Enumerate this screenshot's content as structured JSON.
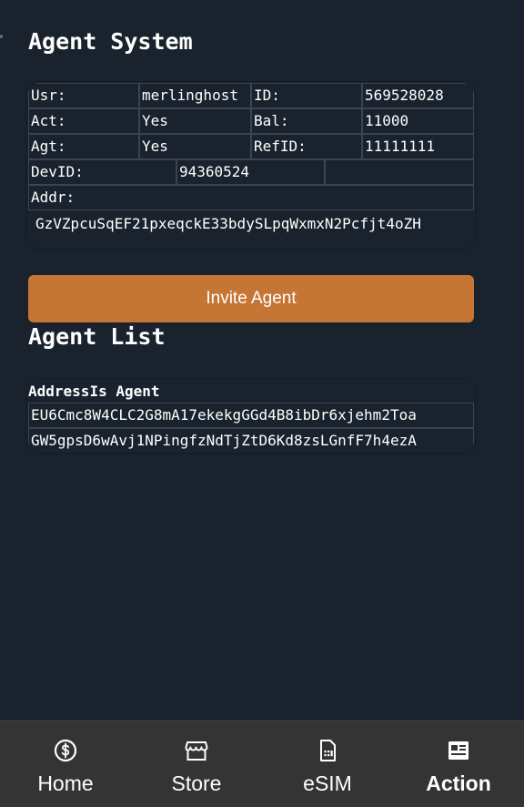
{
  "header": {
    "title": "Agent System"
  },
  "info": {
    "usr_label": "Usr:",
    "usr_value": "merlinghost",
    "id_label": "ID:",
    "id_value": "569528028",
    "act_label": "Act:",
    "act_value": "Yes",
    "bal_label": "Bal:",
    "bal_value": "11000",
    "agt_label": "Agt:",
    "agt_value": "Yes",
    "refid_label": "RefID:",
    "refid_value": "11111111",
    "devid_label": "DevID:",
    "devid_value": "94360524",
    "addr_label": "Addr:",
    "addr_value": "GzVZpcuSqEF21pxeqckE33bdySLpqWxmxN2Pcfjt4oZH"
  },
  "invite_button": {
    "label": "Invite Agent",
    "color": "#c57634"
  },
  "agent_list": {
    "title": "Agent List",
    "headers": [
      "Address",
      "Is Agent"
    ],
    "rows": [
      "EU6Cmc8W4CLC2G8mA17ekekgGGd4B8ibDr6xjehm2Toa",
      "GW5gpsD6wAvj1NPingfzNdTjZtD6Kd8zsLGnfF7h4ezA"
    ]
  },
  "nav": {
    "items": [
      {
        "label": "Home",
        "icon": "dollar-coin-icon",
        "active": false
      },
      {
        "label": "Store",
        "icon": "storefront-icon",
        "active": false
      },
      {
        "label": "eSIM",
        "icon": "sim-card-icon",
        "active": false
      },
      {
        "label": "Action",
        "icon": "news-card-icon",
        "active": true
      }
    ]
  },
  "colors": {
    "background": "#1a222d",
    "nav_background": "#343434",
    "accent": "#c57634"
  }
}
